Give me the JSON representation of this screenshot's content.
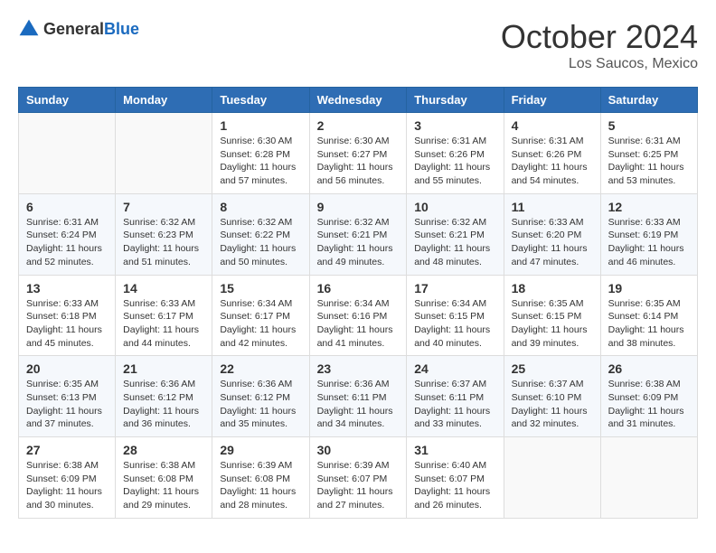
{
  "header": {
    "logo": {
      "general": "General",
      "blue": "Blue"
    },
    "title": "October 2024",
    "location": "Los Saucos, Mexico"
  },
  "calendar": {
    "days_of_week": [
      "Sunday",
      "Monday",
      "Tuesday",
      "Wednesday",
      "Thursday",
      "Friday",
      "Saturday"
    ],
    "weeks": [
      [
        {
          "day": "",
          "info": ""
        },
        {
          "day": "",
          "info": ""
        },
        {
          "day": "1",
          "info": "Sunrise: 6:30 AM\nSunset: 6:28 PM\nDaylight: 11 hours and 57 minutes."
        },
        {
          "day": "2",
          "info": "Sunrise: 6:30 AM\nSunset: 6:27 PM\nDaylight: 11 hours and 56 minutes."
        },
        {
          "day": "3",
          "info": "Sunrise: 6:31 AM\nSunset: 6:26 PM\nDaylight: 11 hours and 55 minutes."
        },
        {
          "day": "4",
          "info": "Sunrise: 6:31 AM\nSunset: 6:26 PM\nDaylight: 11 hours and 54 minutes."
        },
        {
          "day": "5",
          "info": "Sunrise: 6:31 AM\nSunset: 6:25 PM\nDaylight: 11 hours and 53 minutes."
        }
      ],
      [
        {
          "day": "6",
          "info": "Sunrise: 6:31 AM\nSunset: 6:24 PM\nDaylight: 11 hours and 52 minutes."
        },
        {
          "day": "7",
          "info": "Sunrise: 6:32 AM\nSunset: 6:23 PM\nDaylight: 11 hours and 51 minutes."
        },
        {
          "day": "8",
          "info": "Sunrise: 6:32 AM\nSunset: 6:22 PM\nDaylight: 11 hours and 50 minutes."
        },
        {
          "day": "9",
          "info": "Sunrise: 6:32 AM\nSunset: 6:21 PM\nDaylight: 11 hours and 49 minutes."
        },
        {
          "day": "10",
          "info": "Sunrise: 6:32 AM\nSunset: 6:21 PM\nDaylight: 11 hours and 48 minutes."
        },
        {
          "day": "11",
          "info": "Sunrise: 6:33 AM\nSunset: 6:20 PM\nDaylight: 11 hours and 47 minutes."
        },
        {
          "day": "12",
          "info": "Sunrise: 6:33 AM\nSunset: 6:19 PM\nDaylight: 11 hours and 46 minutes."
        }
      ],
      [
        {
          "day": "13",
          "info": "Sunrise: 6:33 AM\nSunset: 6:18 PM\nDaylight: 11 hours and 45 minutes."
        },
        {
          "day": "14",
          "info": "Sunrise: 6:33 AM\nSunset: 6:17 PM\nDaylight: 11 hours and 44 minutes."
        },
        {
          "day": "15",
          "info": "Sunrise: 6:34 AM\nSunset: 6:17 PM\nDaylight: 11 hours and 42 minutes."
        },
        {
          "day": "16",
          "info": "Sunrise: 6:34 AM\nSunset: 6:16 PM\nDaylight: 11 hours and 41 minutes."
        },
        {
          "day": "17",
          "info": "Sunrise: 6:34 AM\nSunset: 6:15 PM\nDaylight: 11 hours and 40 minutes."
        },
        {
          "day": "18",
          "info": "Sunrise: 6:35 AM\nSunset: 6:15 PM\nDaylight: 11 hours and 39 minutes."
        },
        {
          "day": "19",
          "info": "Sunrise: 6:35 AM\nSunset: 6:14 PM\nDaylight: 11 hours and 38 minutes."
        }
      ],
      [
        {
          "day": "20",
          "info": "Sunrise: 6:35 AM\nSunset: 6:13 PM\nDaylight: 11 hours and 37 minutes."
        },
        {
          "day": "21",
          "info": "Sunrise: 6:36 AM\nSunset: 6:12 PM\nDaylight: 11 hours and 36 minutes."
        },
        {
          "day": "22",
          "info": "Sunrise: 6:36 AM\nSunset: 6:12 PM\nDaylight: 11 hours and 35 minutes."
        },
        {
          "day": "23",
          "info": "Sunrise: 6:36 AM\nSunset: 6:11 PM\nDaylight: 11 hours and 34 minutes."
        },
        {
          "day": "24",
          "info": "Sunrise: 6:37 AM\nSunset: 6:11 PM\nDaylight: 11 hours and 33 minutes."
        },
        {
          "day": "25",
          "info": "Sunrise: 6:37 AM\nSunset: 6:10 PM\nDaylight: 11 hours and 32 minutes."
        },
        {
          "day": "26",
          "info": "Sunrise: 6:38 AM\nSunset: 6:09 PM\nDaylight: 11 hours and 31 minutes."
        }
      ],
      [
        {
          "day": "27",
          "info": "Sunrise: 6:38 AM\nSunset: 6:09 PM\nDaylight: 11 hours and 30 minutes."
        },
        {
          "day": "28",
          "info": "Sunrise: 6:38 AM\nSunset: 6:08 PM\nDaylight: 11 hours and 29 minutes."
        },
        {
          "day": "29",
          "info": "Sunrise: 6:39 AM\nSunset: 6:08 PM\nDaylight: 11 hours and 28 minutes."
        },
        {
          "day": "30",
          "info": "Sunrise: 6:39 AM\nSunset: 6:07 PM\nDaylight: 11 hours and 27 minutes."
        },
        {
          "day": "31",
          "info": "Sunrise: 6:40 AM\nSunset: 6:07 PM\nDaylight: 11 hours and 26 minutes."
        },
        {
          "day": "",
          "info": ""
        },
        {
          "day": "",
          "info": ""
        }
      ]
    ]
  }
}
